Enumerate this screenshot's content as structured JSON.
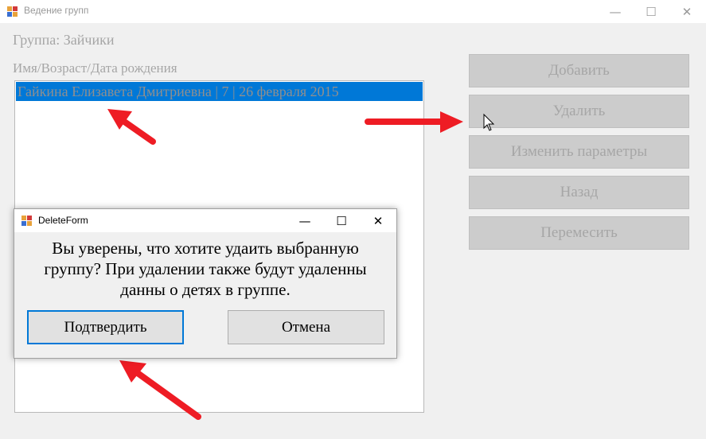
{
  "main_window": {
    "title": "Ведение групп",
    "controls": {
      "minimize": "—",
      "maximize": "☐",
      "close": "✕"
    }
  },
  "group_label": "Группа: Зайчики",
  "list_header": "Имя/Возраст/Дата рождения",
  "list_items": [
    "Гайкина Елизавета Дмитриевна  |   7   |   26 февраля 2015"
  ],
  "buttons": {
    "add": "Добавить",
    "delete": "Удалить",
    "edit": "Изменить параметры",
    "back": "Назад",
    "move": "Перемесить"
  },
  "dialog": {
    "title": "DeleteForm",
    "message_lines": [
      "Вы уверены, что хотите удаить выбранную",
      "группу? При удалении также будут удаленны",
      "данны о детях в группе."
    ],
    "confirm": "Подтвердить",
    "cancel": "Отмена",
    "controls": {
      "minimize": "—",
      "maximize": "☐",
      "close": "✕"
    }
  },
  "colors": {
    "selection": "#0078d7",
    "arrow": "#ee1c24",
    "disabled_text": "#a6a6a6",
    "button_face": "#cccccc"
  },
  "icons": [
    "app-icon",
    "minimize-icon",
    "maximize-icon",
    "close-icon",
    "mouse-cursor-icon",
    "red-arrow-icon"
  ]
}
